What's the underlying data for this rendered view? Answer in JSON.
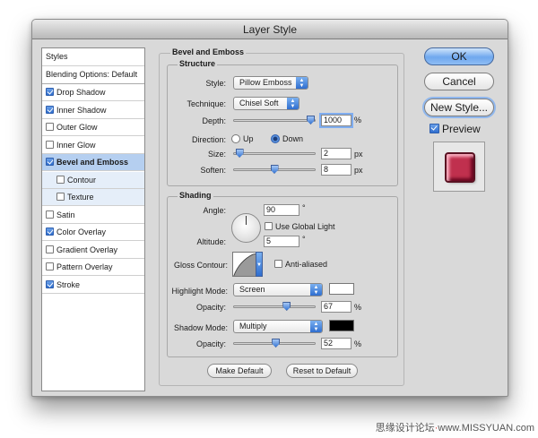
{
  "window": {
    "title": "Layer Style"
  },
  "styles_list": {
    "header": "Styles",
    "blending": "Blending Options: Default",
    "items": [
      {
        "label": "Drop Shadow",
        "checked": true
      },
      {
        "label": "Inner Shadow",
        "checked": true
      },
      {
        "label": "Outer Glow",
        "checked": false
      },
      {
        "label": "Inner Glow",
        "checked": false
      },
      {
        "label": "Bevel and Emboss",
        "checked": true,
        "selected": true
      },
      {
        "label": "Contour",
        "checked": false,
        "sub": true
      },
      {
        "label": "Texture",
        "checked": false,
        "sub": true
      },
      {
        "label": "Satin",
        "checked": false
      },
      {
        "label": "Color Overlay",
        "checked": true
      },
      {
        "label": "Gradient Overlay",
        "checked": false
      },
      {
        "label": "Pattern Overlay",
        "checked": false
      },
      {
        "label": "Stroke",
        "checked": true
      }
    ]
  },
  "bevel": {
    "title": "Bevel and Emboss",
    "structure": {
      "title": "Structure",
      "style_label": "Style:",
      "style_value": "Pillow Emboss",
      "technique_label": "Technique:",
      "technique_value": "Chisel Soft",
      "depth_label": "Depth:",
      "depth_value": "1000",
      "depth_unit": "%",
      "depth_fraction": 1.0,
      "direction_label": "Direction:",
      "direction_up": "Up",
      "direction_down": "Down",
      "direction_selected": "Down",
      "size_label": "Size:",
      "size_value": "2",
      "size_unit": "px",
      "size_fraction": 0.02,
      "soften_label": "Soften:",
      "soften_value": "8",
      "soften_unit": "px",
      "soften_fraction": 0.5
    },
    "shading": {
      "title": "Shading",
      "angle_label": "Angle:",
      "angle_value": "90",
      "angle_unit": "°",
      "global_light_label": "Use Global Light",
      "global_light_checked": false,
      "altitude_label": "Altitude:",
      "altitude_value": "5",
      "altitude_unit": "°",
      "gloss_label": "Gloss Contour:",
      "antialiased_label": "Anti-aliased",
      "antialiased_checked": false,
      "highlight_mode_label": "Highlight Mode:",
      "highlight_mode_value": "Screen",
      "highlight_color": "#ffffff",
      "highlight_opacity_label": "Opacity:",
      "highlight_opacity_value": "67",
      "highlight_opacity_unit": "%",
      "highlight_opacity_fraction": 0.67,
      "shadow_mode_label": "Shadow Mode:",
      "shadow_mode_value": "Multiply",
      "shadow_color": "#000000",
      "shadow_opacity_label": "Opacity:",
      "shadow_opacity_value": "52",
      "shadow_opacity_unit": "%",
      "shadow_opacity_fraction": 0.52
    },
    "make_default": "Make Default",
    "reset_default": "Reset to Default"
  },
  "buttons": {
    "ok": "OK",
    "cancel": "Cancel",
    "new_style": "New Style...",
    "preview": "Preview",
    "preview_checked": true
  },
  "preview_color": "#c0304e",
  "watermark": {
    "left": "思缘设计论坛",
    "sep": "·",
    "right": "www.MISSYUAN.com"
  }
}
